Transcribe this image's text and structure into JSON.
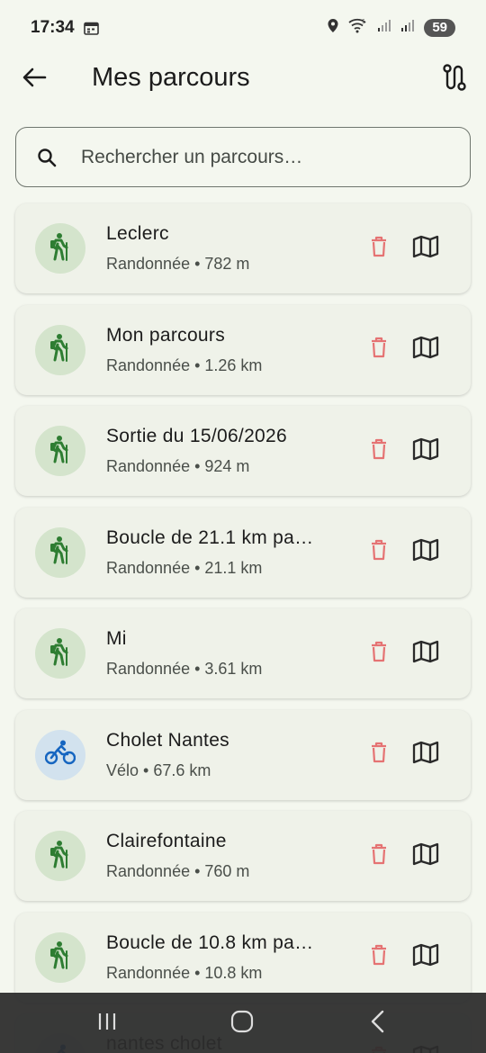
{
  "status": {
    "time": "17:34",
    "battery": "59"
  },
  "app_bar": {
    "title": "Mes parcours"
  },
  "search": {
    "placeholder": "Rechercher un parcours…",
    "value": ""
  },
  "colors": {
    "hike_icon": "#2e7d32",
    "hike_bg": "#d4e4cc",
    "bike_icon": "#1565c0",
    "bike_bg": "#d2e2ee",
    "delete": "#e57373",
    "background": "#f4f7ef",
    "card": "#eff2e9"
  },
  "routes": [
    {
      "name": "Leclerc",
      "subtitle": "Randonnée • 782 m",
      "activity": "hike-icon"
    },
    {
      "name": "Mon parcours",
      "subtitle": "Randonnée • 1.26 km",
      "activity": "hike-icon"
    },
    {
      "name": "Sortie du 15/06/2026",
      "subtitle": "Randonnée • 924 m",
      "activity": "hike-icon"
    },
    {
      "name": "Boucle de 21.1 km pa…",
      "subtitle": "Randonnée • 21.1 km",
      "activity": "hike-icon"
    },
    {
      "name": "Mi",
      "subtitle": "Randonnée • 3.61 km",
      "activity": "hike-icon"
    },
    {
      "name": "Cholet Nantes",
      "subtitle": "Vélo • 67.6 km",
      "activity": "bike-icon"
    },
    {
      "name": "Clairefontaine",
      "subtitle": "Randonnée • 760 m",
      "activity": "hike-icon"
    },
    {
      "name": "Boucle de 10.8 km pa…",
      "subtitle": "Randonnée • 10.8 km",
      "activity": "hike-icon"
    },
    {
      "name": "nantes cholet",
      "subtitle": "",
      "activity": "bike-icon"
    }
  ]
}
